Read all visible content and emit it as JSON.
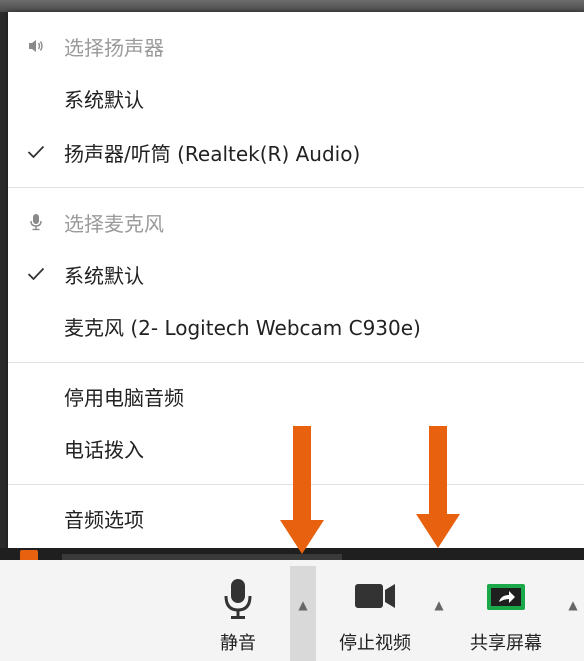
{
  "audio_menu": {
    "speaker_section": {
      "header": "选择扬声器",
      "items": [
        {
          "label": "系统默认",
          "checked": false
        },
        {
          "label": "扬声器/听筒 (Realtek(R) Audio)",
          "checked": true
        }
      ]
    },
    "mic_section": {
      "header": "选择麦克风",
      "items": [
        {
          "label": "系统默认",
          "checked": true
        },
        {
          "label": "麦克风 (2- Logitech Webcam C930e)",
          "checked": false
        }
      ]
    },
    "actions": [
      "停用电脑音频",
      "电话拨入"
    ],
    "options": "音频选项"
  },
  "toolbar": {
    "mute_label": "静音",
    "video_label": "停止视频",
    "share_label": "共享屏幕"
  },
  "colors": {
    "arrow": "#e8610e",
    "share_green": "#1aa84a"
  }
}
